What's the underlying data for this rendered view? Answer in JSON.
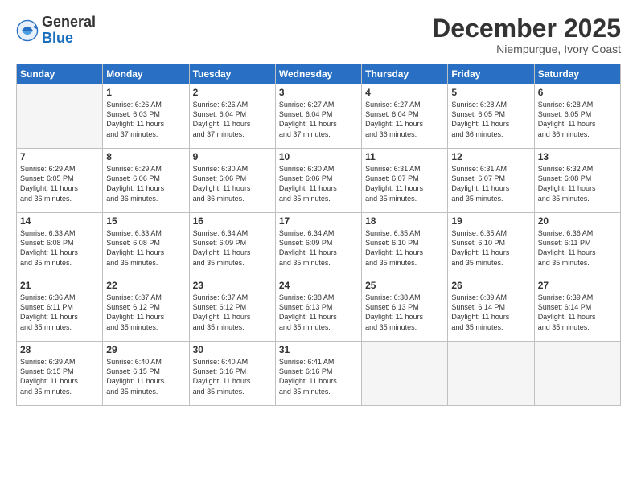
{
  "header": {
    "logo_general": "General",
    "logo_blue": "Blue",
    "month_title": "December 2025",
    "subtitle": "Niempurgue, Ivory Coast"
  },
  "weekdays": [
    "Sunday",
    "Monday",
    "Tuesday",
    "Wednesday",
    "Thursday",
    "Friday",
    "Saturday"
  ],
  "weeks": [
    [
      {
        "day": "",
        "text": ""
      },
      {
        "day": "1",
        "text": "Sunrise: 6:26 AM\nSunset: 6:03 PM\nDaylight: 11 hours\nand 37 minutes."
      },
      {
        "day": "2",
        "text": "Sunrise: 6:26 AM\nSunset: 6:04 PM\nDaylight: 11 hours\nand 37 minutes."
      },
      {
        "day": "3",
        "text": "Sunrise: 6:27 AM\nSunset: 6:04 PM\nDaylight: 11 hours\nand 37 minutes."
      },
      {
        "day": "4",
        "text": "Sunrise: 6:27 AM\nSunset: 6:04 PM\nDaylight: 11 hours\nand 36 minutes."
      },
      {
        "day": "5",
        "text": "Sunrise: 6:28 AM\nSunset: 6:05 PM\nDaylight: 11 hours\nand 36 minutes."
      },
      {
        "day": "6",
        "text": "Sunrise: 6:28 AM\nSunset: 6:05 PM\nDaylight: 11 hours\nand 36 minutes."
      }
    ],
    [
      {
        "day": "7",
        "text": "Sunrise: 6:29 AM\nSunset: 6:05 PM\nDaylight: 11 hours\nand 36 minutes."
      },
      {
        "day": "8",
        "text": "Sunrise: 6:29 AM\nSunset: 6:06 PM\nDaylight: 11 hours\nand 36 minutes."
      },
      {
        "day": "9",
        "text": "Sunrise: 6:30 AM\nSunset: 6:06 PM\nDaylight: 11 hours\nand 36 minutes."
      },
      {
        "day": "10",
        "text": "Sunrise: 6:30 AM\nSunset: 6:06 PM\nDaylight: 11 hours\nand 35 minutes."
      },
      {
        "day": "11",
        "text": "Sunrise: 6:31 AM\nSunset: 6:07 PM\nDaylight: 11 hours\nand 35 minutes."
      },
      {
        "day": "12",
        "text": "Sunrise: 6:31 AM\nSunset: 6:07 PM\nDaylight: 11 hours\nand 35 minutes."
      },
      {
        "day": "13",
        "text": "Sunrise: 6:32 AM\nSunset: 6:08 PM\nDaylight: 11 hours\nand 35 minutes."
      }
    ],
    [
      {
        "day": "14",
        "text": "Sunrise: 6:33 AM\nSunset: 6:08 PM\nDaylight: 11 hours\nand 35 minutes."
      },
      {
        "day": "15",
        "text": "Sunrise: 6:33 AM\nSunset: 6:08 PM\nDaylight: 11 hours\nand 35 minutes."
      },
      {
        "day": "16",
        "text": "Sunrise: 6:34 AM\nSunset: 6:09 PM\nDaylight: 11 hours\nand 35 minutes."
      },
      {
        "day": "17",
        "text": "Sunrise: 6:34 AM\nSunset: 6:09 PM\nDaylight: 11 hours\nand 35 minutes."
      },
      {
        "day": "18",
        "text": "Sunrise: 6:35 AM\nSunset: 6:10 PM\nDaylight: 11 hours\nand 35 minutes."
      },
      {
        "day": "19",
        "text": "Sunrise: 6:35 AM\nSunset: 6:10 PM\nDaylight: 11 hours\nand 35 minutes."
      },
      {
        "day": "20",
        "text": "Sunrise: 6:36 AM\nSunset: 6:11 PM\nDaylight: 11 hours\nand 35 minutes."
      }
    ],
    [
      {
        "day": "21",
        "text": "Sunrise: 6:36 AM\nSunset: 6:11 PM\nDaylight: 11 hours\nand 35 minutes."
      },
      {
        "day": "22",
        "text": "Sunrise: 6:37 AM\nSunset: 6:12 PM\nDaylight: 11 hours\nand 35 minutes."
      },
      {
        "day": "23",
        "text": "Sunrise: 6:37 AM\nSunset: 6:12 PM\nDaylight: 11 hours\nand 35 minutes."
      },
      {
        "day": "24",
        "text": "Sunrise: 6:38 AM\nSunset: 6:13 PM\nDaylight: 11 hours\nand 35 minutes."
      },
      {
        "day": "25",
        "text": "Sunrise: 6:38 AM\nSunset: 6:13 PM\nDaylight: 11 hours\nand 35 minutes."
      },
      {
        "day": "26",
        "text": "Sunrise: 6:39 AM\nSunset: 6:14 PM\nDaylight: 11 hours\nand 35 minutes."
      },
      {
        "day": "27",
        "text": "Sunrise: 6:39 AM\nSunset: 6:14 PM\nDaylight: 11 hours\nand 35 minutes."
      }
    ],
    [
      {
        "day": "28",
        "text": "Sunrise: 6:39 AM\nSunset: 6:15 PM\nDaylight: 11 hours\nand 35 minutes."
      },
      {
        "day": "29",
        "text": "Sunrise: 6:40 AM\nSunset: 6:15 PM\nDaylight: 11 hours\nand 35 minutes."
      },
      {
        "day": "30",
        "text": "Sunrise: 6:40 AM\nSunset: 6:16 PM\nDaylight: 11 hours\nand 35 minutes."
      },
      {
        "day": "31",
        "text": "Sunrise: 6:41 AM\nSunset: 6:16 PM\nDaylight: 11 hours\nand 35 minutes."
      },
      {
        "day": "",
        "text": ""
      },
      {
        "day": "",
        "text": ""
      },
      {
        "day": "",
        "text": ""
      }
    ]
  ]
}
